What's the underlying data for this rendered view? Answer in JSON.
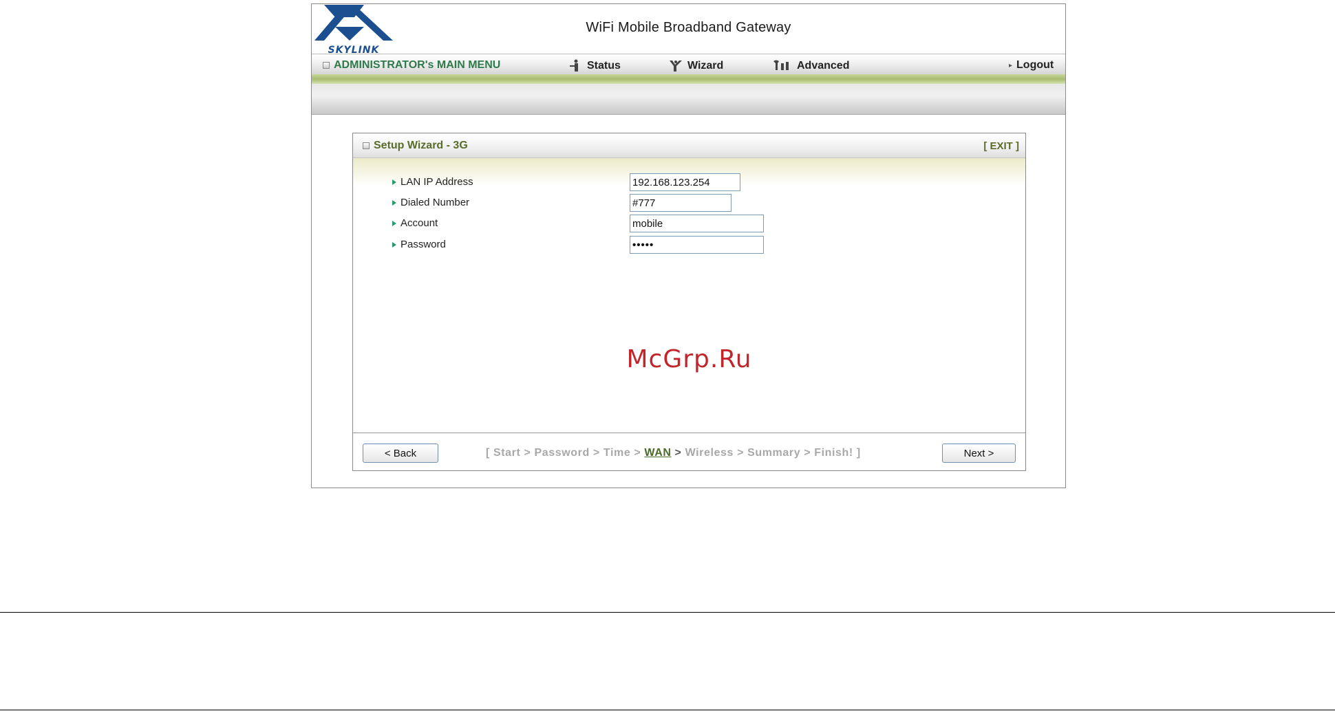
{
  "header": {
    "logo_text": "SKYLINK",
    "title": "WiFi Mobile Broadband Gateway"
  },
  "menu": {
    "admin_label": "ADMINISTRATOR's MAIN MENU",
    "status_label": "Status",
    "wizard_label": "Wizard",
    "advanced_label": "Advanced",
    "logout_label": "Logout"
  },
  "panel": {
    "title": "Setup Wizard - 3G",
    "exit_label": "[ EXIT ]",
    "fields": [
      {
        "label": "LAN IP Address",
        "value": "192.168.123.254"
      },
      {
        "label": "Dialed Number",
        "value": "#777"
      },
      {
        "label": "Account",
        "value": "mobile"
      },
      {
        "label": "Password",
        "value": "•••••"
      }
    ],
    "watermark": "McGrp.Ru",
    "back_label": "< Back",
    "next_label": "Next >",
    "steps": {
      "before": "[ Start > Password > Time > ",
      "current": "WAN",
      "sep": " > ",
      "after": "Wireless > Summary > Finish! ]"
    }
  },
  "colors": {
    "accent_green": "#2f7a4a",
    "panel_title": "#5a6b2a",
    "logo_blue": "#1c4f8f",
    "watermark_red": "#c0262c"
  }
}
